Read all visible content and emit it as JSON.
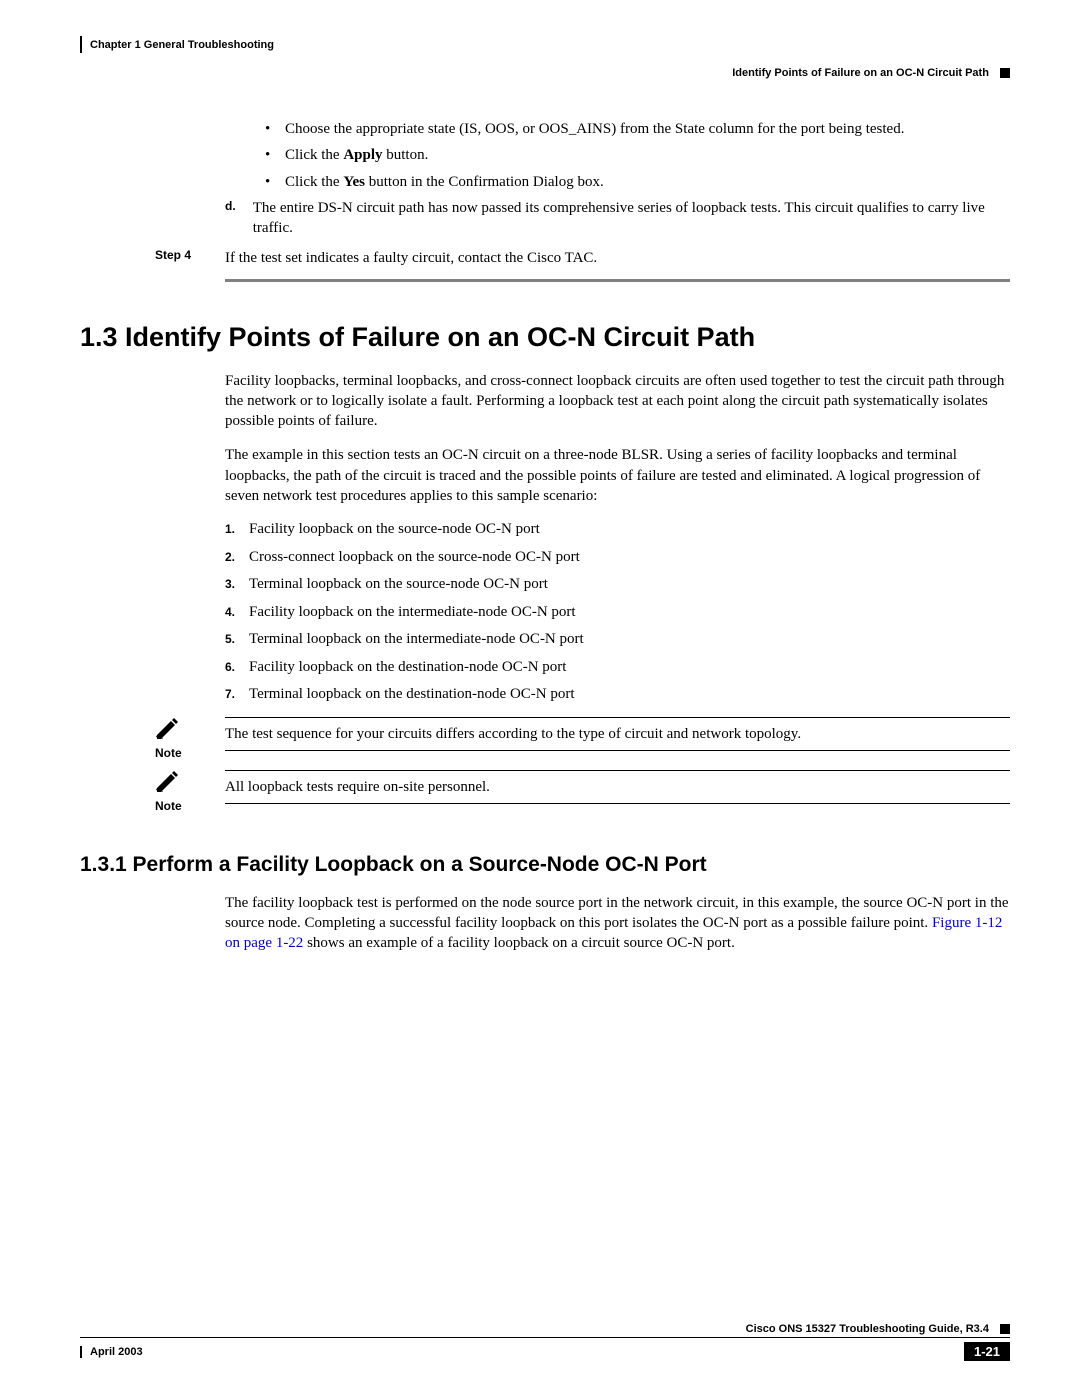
{
  "header": {
    "chapter": "Chapter 1      General Troubleshooting",
    "breadcrumb": "Identify Points of Failure on an OC-N Circuit Path"
  },
  "top": {
    "bullets": [
      "Choose the appropriate state (IS, OOS, or OOS_AINS) from the State column for the port being tested.",
      "Click the ",
      "Click the "
    ],
    "apply_bold": "Apply",
    "apply_tail": " button.",
    "yes_bold": "Yes",
    "yes_tail": " button in the Confirmation Dialog box.",
    "sub_d_marker": "d.",
    "sub_d": "The entire DS-N circuit path has now passed its comprehensive series of loopback tests. This circuit qualifies to carry live traffic.",
    "step4_label": "Step 4",
    "step4": "If the test set indicates a faulty circuit, contact the Cisco TAC."
  },
  "section": {
    "h1": "1.3  Identify Points of Failure on an OC-N Circuit Path",
    "p1": "Facility loopbacks, terminal loopbacks, and cross-connect loopback circuits are often used together to test the circuit path through the network or to logically isolate a fault. Performing a loopback test at each point along the circuit path systematically isolates possible points of failure.",
    "p2": "The example in this section tests an OC-N circuit on a three-node BLSR. Using a series of facility loopbacks and terminal loopbacks, the path of the circuit is traced and the possible points of failure are tested and eliminated. A logical progression of seven network test procedures applies to this sample scenario:",
    "list": [
      "Facility loopback on the source-node OC-N port",
      "Cross-connect loopback on the source-node OC-N port",
      "Terminal loopback on the source-node OC-N port",
      "Facility loopback on the intermediate-node OC-N port",
      "Terminal loopback on the intermediate-node OC-N port",
      "Facility loopback on the destination-node OC-N port",
      "Terminal loopback on the destination-node OC-N port"
    ],
    "note_label": "Note",
    "note1": "The test sequence for your circuits differs according to the type of circuit and network topology.",
    "note2": "All loopback tests require on-site personnel."
  },
  "subsection": {
    "h2": "1.3.1  Perform a Facility Loopback on a Source-Node OC-N Port",
    "p1_a": "The facility loopback test is performed on the node source port in the network circuit, in this example, the source OC-N port in the source node. Completing a successful facility loopback on this port isolates the OC-N port as a possible failure point. ",
    "link": "Figure 1-12 on page 1-22",
    "p1_b": " shows an example of a facility loopback on a circuit source OC-N port."
  },
  "footer": {
    "guide": "Cisco ONS 15327 Troubleshooting Guide, R3.4",
    "date": "April 2003",
    "page": "1-21"
  }
}
